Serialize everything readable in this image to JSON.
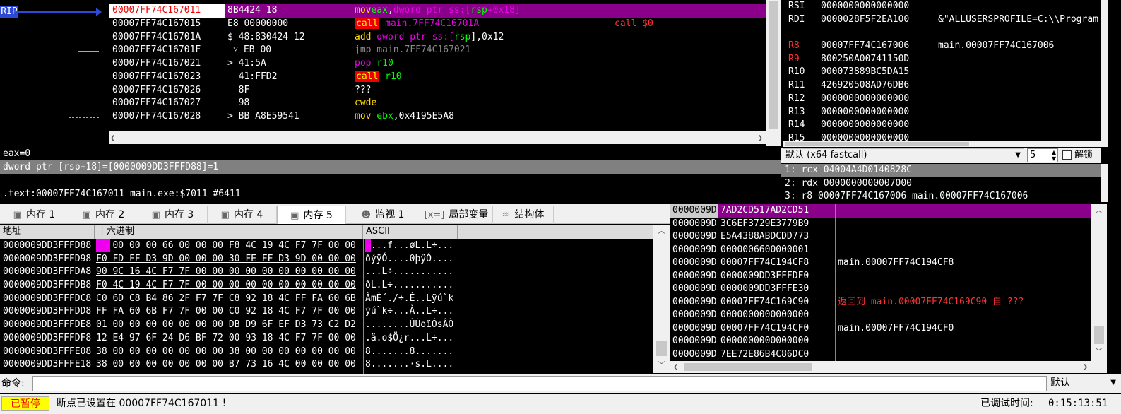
{
  "disasm": {
    "rip_label": "RIP",
    "rows": [
      {
        "addr": "00007FF74C167011",
        "bytes": "8B4424 18",
        "mn": "mov",
        "ops": [
          {
            "t": "eax",
            "c": "reg"
          },
          {
            "t": ",",
            "c": ""
          },
          {
            "t": "dword ptr ss:[",
            "c": "mem"
          },
          {
            "t": "rsp",
            "c": "reg"
          },
          {
            "t": "+0x18]",
            "c": "mem"
          }
        ],
        "cmt": "",
        "sel": true,
        "k": "k-mov"
      },
      {
        "addr": "00007FF74C167015",
        "bytes": "E8 00000000",
        "mn": "call",
        "ops": [
          {
            "t": " main.7FF74C16701A",
            "c": "k-call-tgt"
          }
        ],
        "cmt": "call $0",
        "k": "k-call"
      },
      {
        "addr": "00007FF74C16701A",
        "bytes": "$ 48:830424 12",
        "mn": "add",
        "ops": [
          {
            "t": " qword ptr ss:[",
            "c": "mem"
          },
          {
            "t": "rsp",
            "c": "reg"
          },
          {
            "t": "],0x12",
            "c": ""
          }
        ],
        "cmt": "",
        "k": "k-add"
      },
      {
        "addr": "00007FF74C16701F",
        "bytes": " ˅ EB 00",
        "mn": "jmp",
        "ops": [
          {
            "t": " main.7FF74C167021",
            "c": "q"
          }
        ],
        "cmt": "",
        "k": "k-jmp"
      },
      {
        "addr": "00007FF74C167021",
        "bytes": "> 41:5A",
        "mn": "pop",
        "ops": [
          {
            "t": " r10",
            "c": "reg"
          }
        ],
        "cmt": "",
        "k": "k-pop"
      },
      {
        "addr": "00007FF74C167023",
        "bytes": "  41:FFD2",
        "mn": "call",
        "ops": [
          {
            "t": " r10",
            "c": "reg"
          }
        ],
        "cmt": "",
        "k": "k-call"
      },
      {
        "addr": "00007FF74C167026",
        "bytes": "  8F",
        "mn": "???",
        "ops": [],
        "cmt": "",
        "k": ""
      },
      {
        "addr": "00007FF74C167027",
        "bytes": "  98",
        "mn": "cwde",
        "ops": [],
        "cmt": "",
        "k": "k-cwde"
      },
      {
        "addr": "00007FF74C167028",
        "bytes": "> BB A8E59541",
        "mn": "mov",
        "ops": [
          {
            "t": " ebx",
            "c": "reg"
          },
          {
            "t": ",0x4195E5A8",
            "c": ""
          }
        ],
        "cmt": "",
        "k": "k-mov"
      }
    ]
  },
  "registers": [
    {
      "n": "RSI",
      "v": "0000000000000000",
      "c": "",
      "red": false
    },
    {
      "n": "RDI",
      "v": "0000028F5F2EA100",
      "c": "&\"ALLUSERSPROFILE=C:\\\\Program",
      "red": false
    },
    {
      "n": "",
      "v": "",
      "c": "",
      "red": false
    },
    {
      "n": "R8",
      "v": "00007FF74C167006",
      "c": "main.00007FF74C167006",
      "red": true
    },
    {
      "n": "R9",
      "v": "800250A00741150D",
      "c": "",
      "red": true
    },
    {
      "n": "R10",
      "v": "000073889BC5DA15",
      "c": "",
      "red": false
    },
    {
      "n": "R11",
      "v": "426920508AD76DB6",
      "c": "",
      "red": false
    },
    {
      "n": "R12",
      "v": "0000000000000000",
      "c": "",
      "red": false
    },
    {
      "n": "R13",
      "v": "0000000000000000",
      "c": "",
      "red": false
    },
    {
      "n": "R14",
      "v": "0000000000000000",
      "c": "",
      "red": false
    },
    {
      "n": "R15",
      "v": "0000000000000000",
      "c": "",
      "red": false
    }
  ],
  "info": {
    "line1": "eax=0",
    "line2": "dword ptr [rsp+18]=[0000009DD3FFFD88]=1",
    "line3": "",
    "line4": ".text:00007FF74C167011 main.exe:$7011 #6411"
  },
  "callconv": {
    "selected": "默认 (x64 fastcall)",
    "count": "5",
    "lock_label": "解锁",
    "args": [
      "1: rcx 04004A4D0140828C",
      "2: rdx 0000000000007000",
      "3: r8 00007FF74C167006 main.00007FF74C167006"
    ]
  },
  "tabs": [
    {
      "label": "内存 1",
      "icon": "▣"
    },
    {
      "label": "内存 2",
      "icon": "▣"
    },
    {
      "label": "内存 3",
      "icon": "▣"
    },
    {
      "label": "内存 4",
      "icon": "▣"
    },
    {
      "label": "内存 5",
      "icon": "▣",
      "active": true
    },
    {
      "label": "监视 1",
      "icon": "☻"
    },
    {
      "label": "局部变量",
      "icon": "[x=]"
    },
    {
      "label": "结构体",
      "icon": "♒"
    }
  ],
  "hex": {
    "headers": [
      "地址",
      "十六进制",
      "ASCII"
    ],
    "rows": [
      {
        "a": "0000009DD3FFFD88",
        "x": "01 00 00 00 66 00 00 00 F8 4C 19 4C F7 7F 00 00",
        "s": "....f...øL.L÷..."
      },
      {
        "a": "0000009DD3FFFD98",
        "x": "F0 FD FF D3 9D 00 00 00 30 FE FF D3 9D 00 00 00",
        "s": "ðýÿÓ....0þÿÓ...."
      },
      {
        "a": "0000009DD3FFFDA8",
        "x": "90 9C 16 4C F7 7F 00 00 00 00 00 00 00 00 00 00",
        "s": "...L÷..........."
      },
      {
        "a": "0000009DD3FFFDB8",
        "x": "F0 4C 19 4C F7 7F 00 00 00 00 00 00 00 00 00 00",
        "s": "ðL.L÷..........."
      },
      {
        "a": "0000009DD3FFFDC8",
        "x": "C0 6D C8 B4 86 2F F7 7F C8 92 18 4C FF FA 60 6B",
        "s": "ÀmÈ´./÷.È..Lÿú`k"
      },
      {
        "a": "0000009DD3FFFDD8",
        "x": "FF FA 60 6B F7 7F 00 00 C0 92 18 4C F7 7F 00 00",
        "s": "ÿú`k÷...À..L÷..."
      },
      {
        "a": "0000009DD3FFFDE8",
        "x": "01 00 00 00 00 00 00 00 DB D9 6F EF D3 73 C2 D2",
        "s": "........ÛÙoïÓsÂÒ"
      },
      {
        "a": "0000009DD3FFFDF8",
        "x": "12 E4 97 6F 24 D6 BF 72 00 93 18 4C F7 7F 00 00",
        "s": ".ä.o$Ö¿r...L÷..."
      },
      {
        "a": "0000009DD3FFFE08",
        "x": "38 00 00 00 00 00 00 00 38 00 00 00 00 00 00 00",
        "s": "8.......8......."
      },
      {
        "a": "0000009DD3FFFE18",
        "x": "38 00 00 00 00 00 00 00 B7 73 16 4C 00 00 00 00",
        "s": "8.......·s.L...."
      }
    ]
  },
  "stack": [
    {
      "a": "0000009D",
      "v": "7AD2CD517AD2CD51",
      "c": "",
      "sel": true
    },
    {
      "a": "0000009D",
      "v": "3C6EF3729E3779B9",
      "c": ""
    },
    {
      "a": "0000009D",
      "v": "E5A4388ABDCDD773",
      "c": ""
    },
    {
      "a": "0000009D",
      "v": "0000006600000001",
      "c": ""
    },
    {
      "a": "0000009D",
      "v": "00007FF74C194CF8",
      "c": "main.00007FF74C194CF8"
    },
    {
      "a": "0000009D",
      "v": "0000009DD3FFFDF0",
      "c": ""
    },
    {
      "a": "0000009D",
      "v": "0000009DD3FFFE30",
      "c": ""
    },
    {
      "a": "0000009D",
      "v": "00007FF74C169C90",
      "c": "返回到 main.00007FF74C169C90 自 ???",
      "red": true
    },
    {
      "a": "0000009D",
      "v": "0000000000000000",
      "c": ""
    },
    {
      "a": "0000009D",
      "v": "00007FF74C194CF0",
      "c": "main.00007FF74C194CF0"
    },
    {
      "a": "0000009D",
      "v": "0000000000000000",
      "c": ""
    },
    {
      "a": "0000009D",
      "v": "7EE72E86B4C86DC0",
      "c": ""
    }
  ],
  "command": {
    "label": "命令:",
    "value": "",
    "mode": "默认"
  },
  "status": {
    "state": "已暂停",
    "message": "断点已设置在 00007FF74C167011 !",
    "time_label": "已调试时间:",
    "time": "0:15:13:51"
  }
}
